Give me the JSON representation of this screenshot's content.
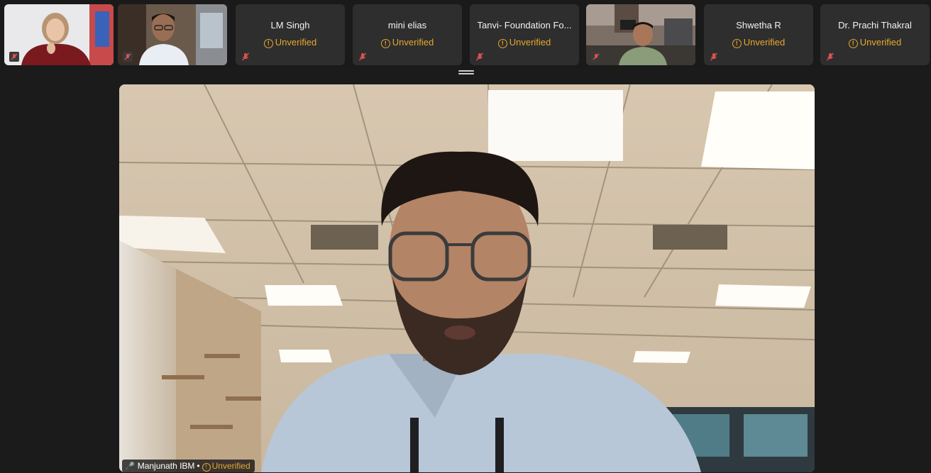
{
  "participants": [
    {
      "type": "video"
    },
    {
      "type": "video"
    },
    {
      "type": "name",
      "name": "LM Singh",
      "status": "Unverified"
    },
    {
      "type": "name",
      "name": "mini elias",
      "status": "Unverified"
    },
    {
      "type": "name",
      "name": "Tanvi- Foundation Fo...",
      "status": "Unverified"
    },
    {
      "type": "video"
    },
    {
      "type": "name",
      "name": "Shwetha R",
      "status": "Unverified"
    },
    {
      "type": "name",
      "name": "Dr. Prachi Thakral",
      "status": "Unverified"
    }
  ],
  "speaker": {
    "name": "Manjunath IBM",
    "separator": "•",
    "status": "Unverified"
  },
  "colors": {
    "unverified": "#e7a72f",
    "muted_mic": "#d9534f",
    "active_mic": "#3fd66a",
    "tile_bg": "#2e2e2e",
    "background": "#1b1b1b"
  },
  "icons": {
    "muted": "mic-muted-icon",
    "warning": "warning-circle-icon",
    "handle": "resize-handle-icon"
  }
}
